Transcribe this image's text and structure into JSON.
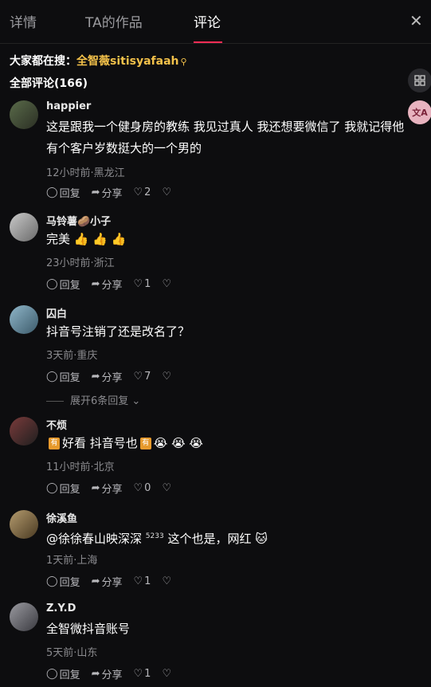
{
  "tabs": {
    "details": "详情",
    "works": "TA的作品",
    "comments": "评论",
    "close": "✕"
  },
  "search": {
    "prefix": "大家都在搜：",
    "term": "全智薇sitisyafaah",
    "icon": "search-icon"
  },
  "comment_count": {
    "label": "全部评论",
    "count": "(166)"
  },
  "side_buttons": {
    "grid_icon": "grid-icon",
    "translate_label": "文A"
  },
  "comments": [
    {
      "name": "happier",
      "content": "这是跟我一个健身房的教练 我见过真人 我还想要微信了 我就记得他有个客户岁数挺大的一个男的",
      "meta": "12小时前·黑龙江",
      "reply": "回复",
      "share": "分享",
      "likes": "2"
    },
    {
      "name": "马铃薯🥔小子",
      "content": "完美 👍 👍 👍",
      "meta": "23小时前·浙江",
      "reply": "回复",
      "share": "分享",
      "likes": "1"
    },
    {
      "name": "囚白",
      "content": "抖音号注销了还是改名了？",
      "meta": "3天前·重庆",
      "reply": "回复",
      "share": "分享",
      "likes": "7"
    },
    {
      "name": "不烦",
      "content_a": "好看 抖音号也",
      "content_b": "😭 😭 😭",
      "meta": "11小时前·北京",
      "reply": "回复",
      "share": "分享",
      "likes": "0"
    },
    {
      "name": "徐溪鱼",
      "mention": "@徐徐春山映深深",
      "mention_mark": "5233",
      "content": "这个也是，网红 🐱",
      "meta": "1天前·上海",
      "reply": "回复",
      "share": "分享",
      "likes": "1"
    },
    {
      "name": "Z.Y.D",
      "content": "全智微抖音账号",
      "meta": "5天前·山东",
      "reply": "回复",
      "share": "分享",
      "likes": "1"
    }
  ],
  "expand_replies": "展开6条回复",
  "colors": {
    "background": "#0d0d0f",
    "accent": "#fe2c55",
    "search_term": "#f3c14a",
    "meta": "#8a8a8e"
  }
}
